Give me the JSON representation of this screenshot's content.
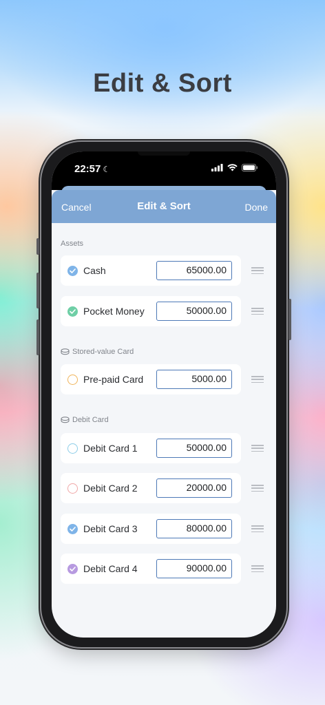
{
  "hero": {
    "title": "Edit & Sort"
  },
  "status_bar": {
    "time": "22:57"
  },
  "nav": {
    "cancel": "Cancel",
    "title": "Edit & Sort",
    "done": "Done"
  },
  "sections": {
    "assets": {
      "label": "Assets"
    },
    "stored_value": {
      "label": "Stored-value Card",
      "icon": "coins-icon"
    },
    "debit": {
      "label": "Debit Card",
      "icon": "coins-icon"
    }
  },
  "accounts": [
    {
      "label": "Cash",
      "amount": "65000.00",
      "color": "#7fb4e8",
      "checked": true
    },
    {
      "label": "Pocket Money",
      "amount": "50000.00",
      "color": "#6fcfa6",
      "checked": true
    },
    {
      "label": "Pre-paid Card",
      "amount": "5000.00",
      "color": "#f0b45a",
      "checked": false
    },
    {
      "label": "Debit Card 1",
      "amount": "50000.00",
      "color": "#8ccde8",
      "checked": false
    },
    {
      "label": "Debit Card 2",
      "amount": "20000.00",
      "color": "#f0a7a7",
      "checked": false
    },
    {
      "label": "Debit Card 3",
      "amount": "80000.00",
      "color": "#7fb4e8",
      "checked": true
    },
    {
      "label": "Debit Card 4",
      "amount": "90000.00",
      "color": "#b79ae0",
      "checked": true
    }
  ]
}
